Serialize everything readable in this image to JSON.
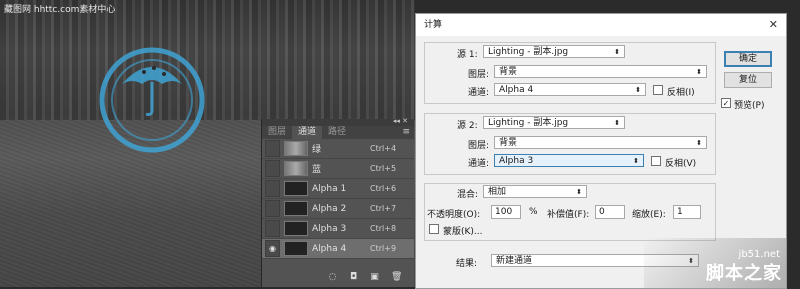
{
  "canvas": {
    "watermark_tl": "藏图网 hhttc.com素材中心"
  },
  "channels_panel": {
    "tabs": [
      "图层",
      "通道",
      "路径"
    ],
    "active_tab": 1,
    "channels": [
      {
        "name": "绿",
        "shortcut": "Ctrl+4",
        "thumb": "light",
        "visible": false
      },
      {
        "name": "蓝",
        "shortcut": "Ctrl+5",
        "thumb": "light",
        "visible": false
      },
      {
        "name": "Alpha 1",
        "shortcut": "Ctrl+6",
        "thumb": "dark",
        "visible": false
      },
      {
        "name": "Alpha 2",
        "shortcut": "Ctrl+7",
        "thumb": "dark",
        "visible": false
      },
      {
        "name": "Alpha 3",
        "shortcut": "Ctrl+8",
        "thumb": "dark",
        "visible": false
      },
      {
        "name": "Alpha 4",
        "shortcut": "Ctrl+9",
        "thumb": "dark",
        "visible": true,
        "selected": true
      }
    ]
  },
  "dialog": {
    "title": "计算",
    "close_glyph": "✕",
    "source1": {
      "label": "源 1:",
      "file": "Lighting - 副本.jpg",
      "layer_label": "图层:",
      "layer": "背景",
      "channel_label": "通道:",
      "channel": "Alpha 4",
      "invert_label": "反相(I)",
      "invert_checked": false
    },
    "source2": {
      "label": "源 2:",
      "file": "Lighting - 副本.jpg",
      "layer_label": "图层:",
      "layer": "背景",
      "channel_label": "通道:",
      "channel": "Alpha 3",
      "invert_label": "反相(V)",
      "invert_checked": false
    },
    "blending": {
      "label": "混合:",
      "mode": "相加",
      "opacity_label": "不透明度(O):",
      "opacity": "100",
      "percent": "%",
      "offset_label": "补偿值(F):",
      "offset": "0",
      "scale_label": "缩放(E):",
      "scale": "1",
      "mask_label": "蒙版(K)...",
      "mask_checked": false
    },
    "result": {
      "label": "结果:",
      "value": "新建通道"
    },
    "buttons": {
      "ok": "确定",
      "reset": "复位",
      "preview_label": "预览(P)",
      "preview_checked": true
    }
  },
  "corner_watermark": {
    "url": "jb51.net",
    "brand": "脚本之家"
  },
  "colors": {
    "stamp_blue": "#3fa3d4",
    "dialog_bg": "#f0f0f0",
    "panel_bg": "#535353"
  }
}
